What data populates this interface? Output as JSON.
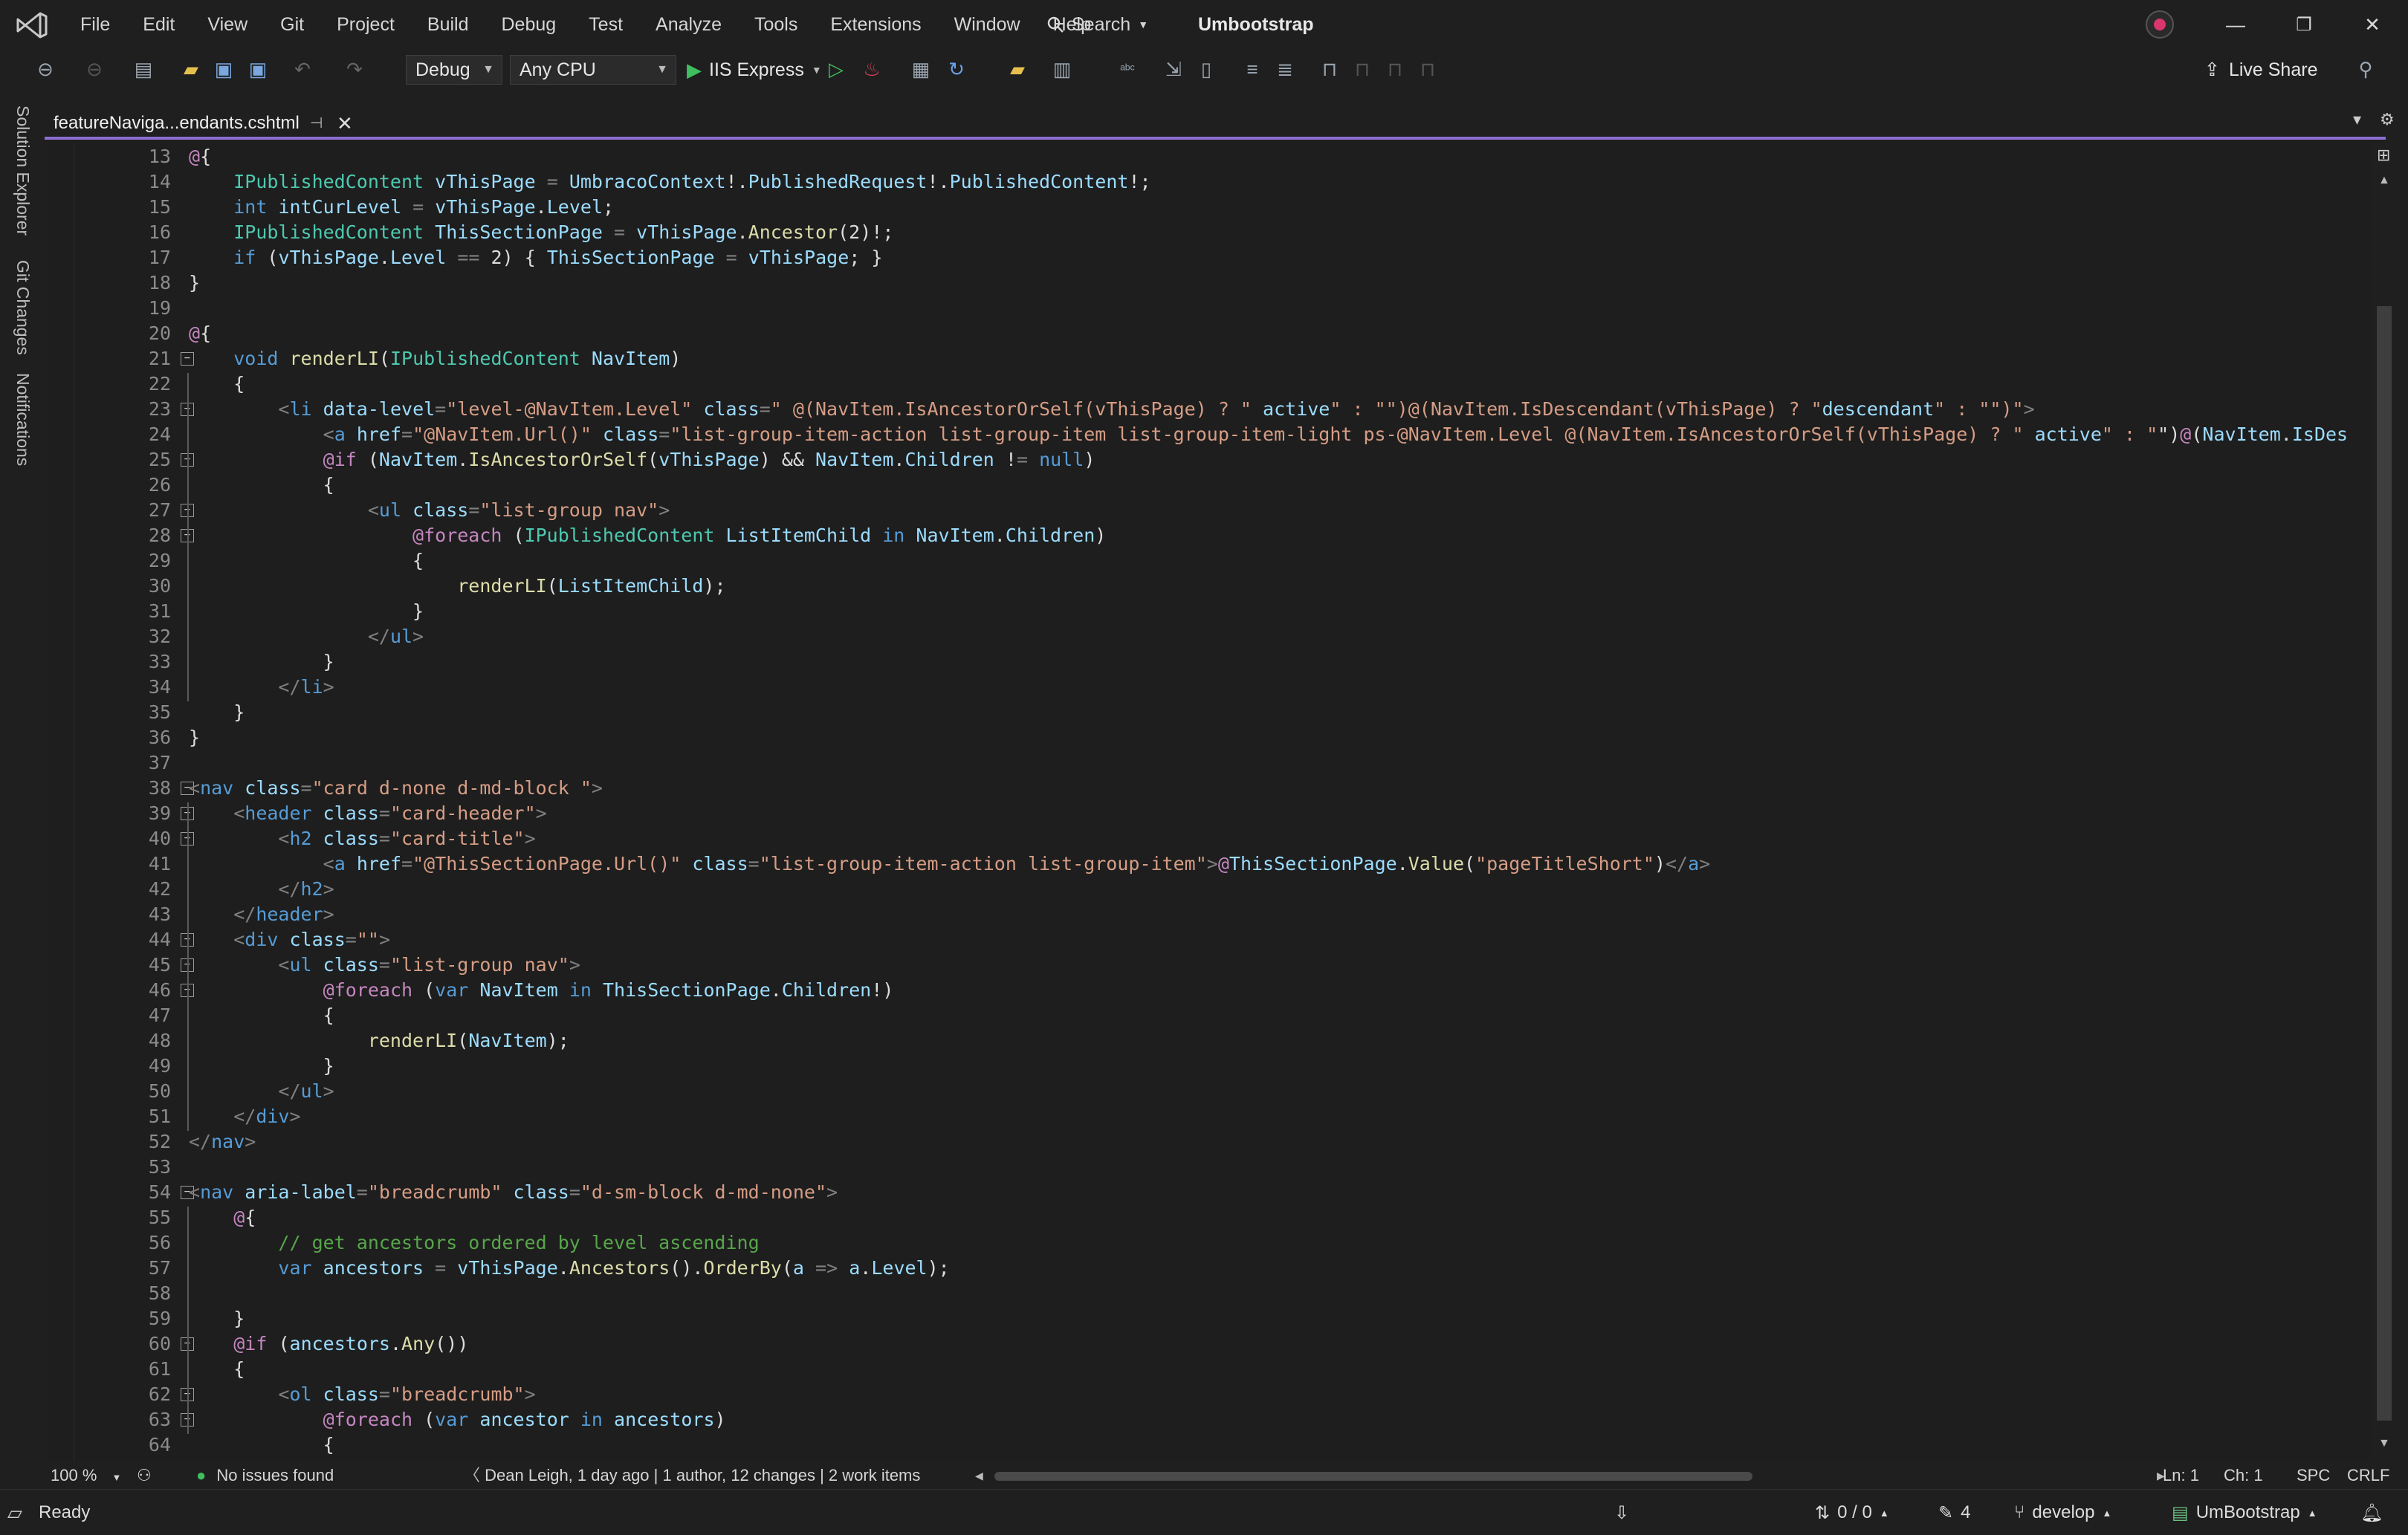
{
  "menubar": {
    "items": [
      "File",
      "Edit",
      "View",
      "Git",
      "Project",
      "Build",
      "Debug",
      "Test",
      "Analyze",
      "Tools",
      "Extensions",
      "Window",
      "Help"
    ],
    "search_label": "Search",
    "solution_name": "Umbootstrap"
  },
  "toolbar": {
    "configuration": "Debug",
    "platform": "Any CPU",
    "start_target": "IIS Express",
    "live_share_label": "Live Share"
  },
  "side_panels": [
    "Solution Explorer",
    "Git Changes",
    "Notifications"
  ],
  "document_tab": {
    "title": "featureNaviga...endants.cshtml"
  },
  "editor": {
    "first_line": 13,
    "lines": [
      "@{",
      "    IPublishedContent vThisPage = UmbracoContext!.PublishedRequest!.PublishedContent!;",
      "    int intCurLevel = vThisPage.Level;",
      "    IPublishedContent ThisSectionPage = vThisPage.Ancestor(2)!;",
      "    if (vThisPage.Level == 2) { ThisSectionPage = vThisPage; }",
      "}",
      "",
      "@{",
      "    void renderLI(IPublishedContent NavItem)",
      "    {",
      "        <li data-level=\"level-@NavItem.Level\" class=\" @(NavItem.IsAncestorOrSelf(vThisPage) ? \" active\" : \"\")@(NavItem.IsDescendant(vThisPage) ? \"descendant\" : \"\")\">",
      "            <a href=\"@NavItem.Url()\" class=\"list-group-item-action list-group-item list-group-item-light ps-@NavItem.Level @(NavItem.IsAncestorOrSelf(vThisPage) ? \" active\" : \"\")@(NavItem.IsDes",
      "            @if (NavItem.IsAncestorOrSelf(vThisPage) && NavItem.Children != null)",
      "            {",
      "                <ul class=\"list-group nav\">",
      "                    @foreach (IPublishedContent ListItemChild in NavItem.Children)",
      "                    {",
      "                        renderLI(ListItemChild);",
      "                    }",
      "                </ul>",
      "            }",
      "        </li>",
      "    }",
      "}",
      "",
      "<nav class=\"card d-none d-md-block \">",
      "    <header class=\"card-header\">",
      "        <h2 class=\"card-title\">",
      "            <a href=\"@ThisSectionPage.Url()\" class=\"list-group-item-action list-group-item\">@ThisSectionPage.Value(\"pageTitleShort\")</a>",
      "        </h2>",
      "    </header>",
      "    <div class=\"\">",
      "        <ul class=\"list-group nav\">",
      "            @foreach (var NavItem in ThisSectionPage.Children!)",
      "            {",
      "                renderLI(NavItem);",
      "            }",
      "        </ul>",
      "    </div>",
      "</nav>",
      "",
      "<nav aria-label=\"breadcrumb\" class=\"d-sm-block d-md-none\">",
      "    @{",
      "        // get ancestors ordered by level ascending",
      "        var ancestors = vThisPage.Ancestors().OrderBy(a => a.Level);",
      "",
      "    }",
      "    @if (ancestors.Any())",
      "    {",
      "        <ol class=\"breadcrumb\">",
      "            @foreach (var ancestor in ancestors)",
      "            {"
    ]
  },
  "editor_status": {
    "zoom": "100 %",
    "issues": "No issues found",
    "codelens": "Dean Leigh, 1 day ago | 1 author, 12 changes | 2 work items",
    "line": "Ln: 1",
    "char": "Ch: 1",
    "whitespace": "SPC",
    "line_ending": "CRLF"
  },
  "statusbar": {
    "ready": "Ready",
    "sync": "0 / 0",
    "pending_changes": "4",
    "branch": "develop",
    "repository": "UmBootstrap"
  },
  "colors": {
    "accent": "#8c6fd1",
    "background": "#1e1e1e",
    "keyword": "#569cd6",
    "type": "#4ec9b0",
    "string": "#d69d85",
    "comment": "#57a64a"
  }
}
